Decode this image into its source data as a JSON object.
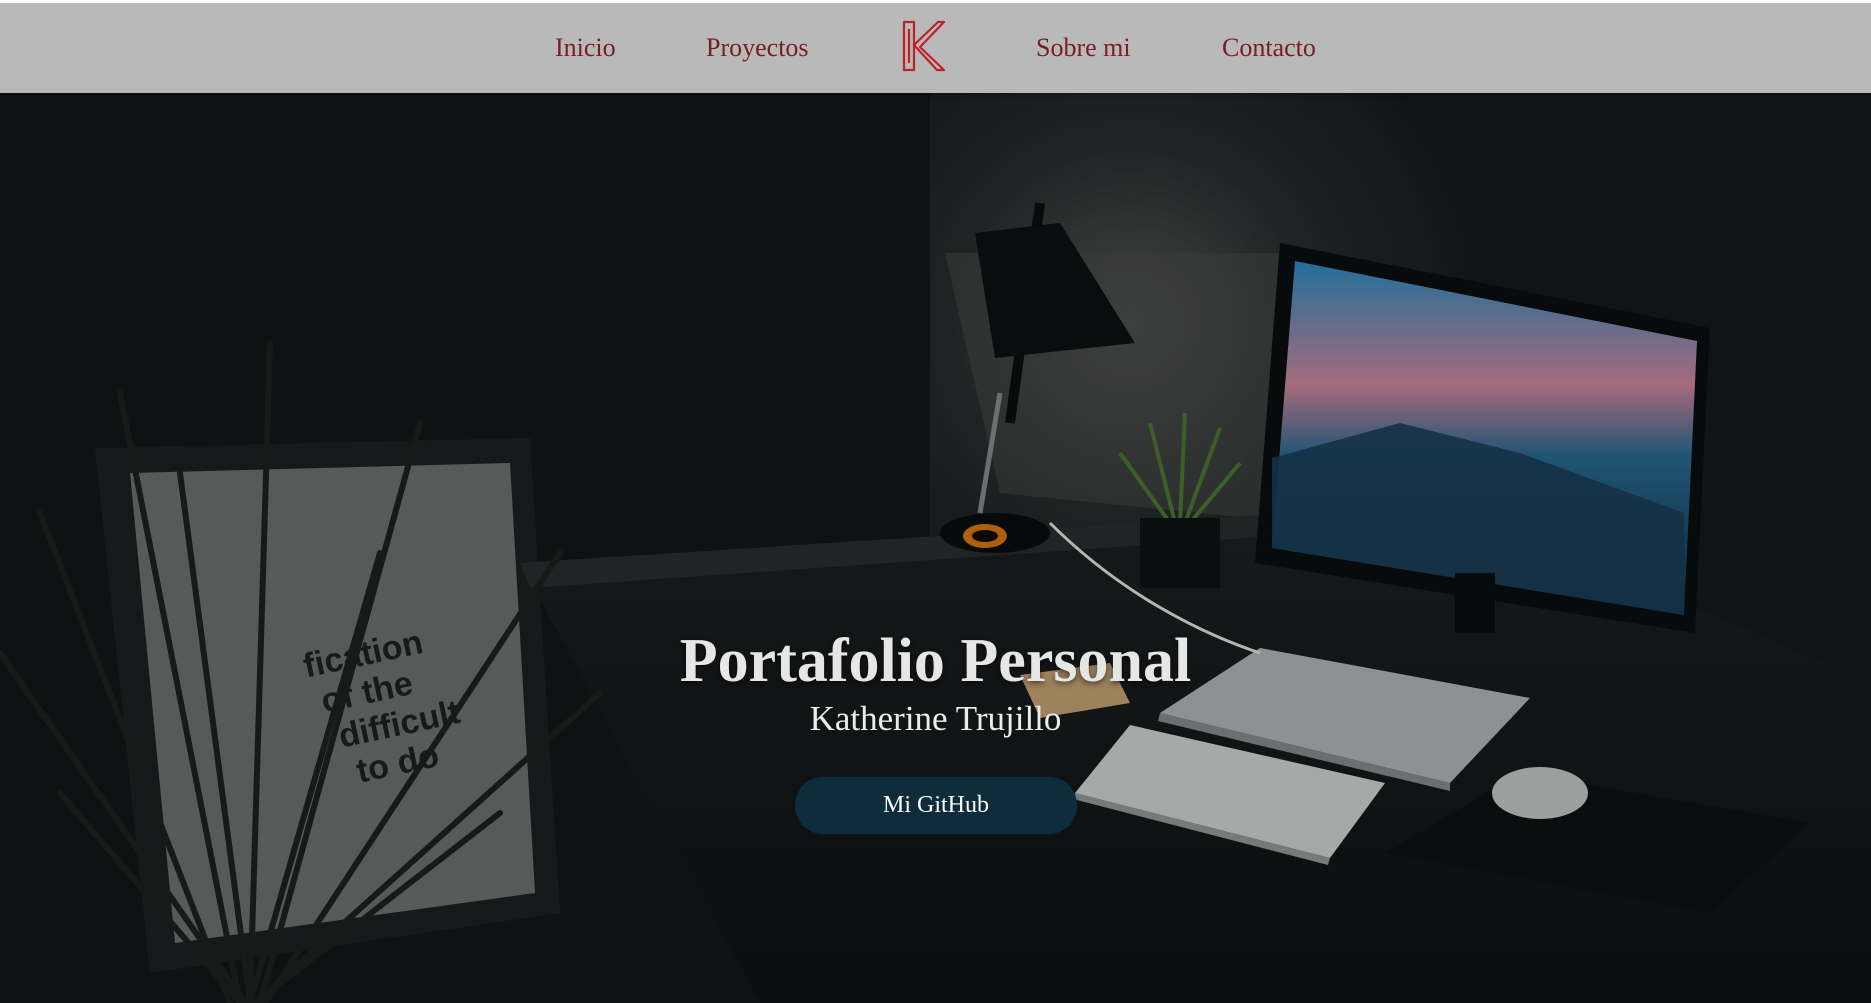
{
  "nav": {
    "items": [
      {
        "label": "Inicio"
      },
      {
        "label": "Proyectos"
      },
      {
        "label": "Sobre mi"
      },
      {
        "label": "Contacto"
      }
    ]
  },
  "hero": {
    "title": "Portafolio Personal",
    "subtitle": "Katherine Trujillo",
    "cta_label": "Mi GitHub",
    "poster_text": [
      "fication",
      "of the",
      "difficult",
      "to do"
    ]
  },
  "colors": {
    "nav_background": "#b8b9b8",
    "nav_text": "#7a1d23",
    "logo": "#c0202a",
    "hero_background": "#121a1b",
    "cta_background": "#0f2c3c"
  },
  "icons": {
    "logo": "k-monogram-logo"
  }
}
